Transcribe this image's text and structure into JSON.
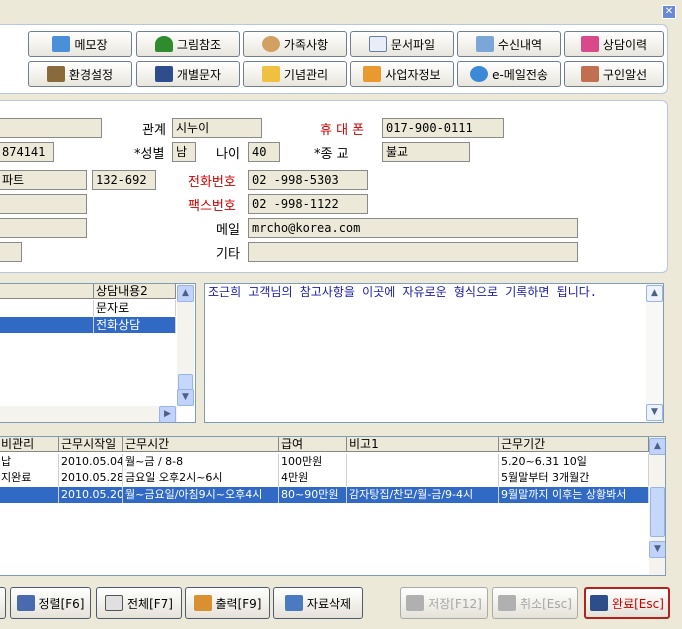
{
  "toolbar_top": [
    {
      "label": "메모장",
      "icon": "memo-icon"
    },
    {
      "label": "그림참조",
      "icon": "tree-icon"
    },
    {
      "label": "가족사항",
      "icon": "family-icon"
    },
    {
      "label": "문서파일",
      "icon": "document-icon"
    },
    {
      "label": "수신내역",
      "icon": "inbox-icon"
    },
    {
      "label": "상담이력",
      "icon": "history-icon"
    }
  ],
  "toolbar_bottom": [
    {
      "label": "환경설정",
      "icon": "settings-icon"
    },
    {
      "label": "개별문자",
      "icon": "sms-icon"
    },
    {
      "label": "기념관리",
      "icon": "anniversary-icon"
    },
    {
      "label": "사업자정보",
      "icon": "business-icon"
    },
    {
      "label": "e-메일전송",
      "icon": "email-icon"
    },
    {
      "label": "구인알선",
      "icon": "recruit-icon"
    }
  ],
  "info": {
    "relation_label": "관계",
    "relation_value": "시누이",
    "mobile_label": "휴 대 폰",
    "mobile_value": "017-900-0111",
    "idnum_value": "874141",
    "gender_label": "*성별",
    "gender_value": "남",
    "age_label": "나이",
    "age_value": "40",
    "religion_label": "*종     교",
    "religion_value": "불교",
    "address_value": "파트",
    "zip_value": "132-692",
    "phone_label": "전화번호",
    "phone_value": "02  -998-5303",
    "fax_label": "팩스번호",
    "fax_value": "02  -998-1122",
    "email_label": "메일",
    "email_value": "mrcho@korea.com",
    "etc_label": "기타",
    "etc_value": ""
  },
  "consult_list": {
    "header": "상담내용2",
    "rows": [
      "문자로",
      "전화상담"
    ],
    "selected_index": 1
  },
  "memo_text": "조근희 고객님의 참고사항을 이곳에 자유로운 형식으로 기록하면 됩니다.",
  "work_table": {
    "headers": [
      "비관리",
      "근무시작일",
      "근무시간",
      "급여",
      "비고1",
      "근무기간"
    ],
    "rows": [
      [
        "납",
        "2010.05.04",
        "월~금 / 8-8",
        "100만원",
        "",
        "5.20~6.31 10일"
      ],
      [
        "지완료",
        "2010.05.28",
        "금요일 오후2시~6시",
        "4만원",
        "",
        "5월말부터 3개월간"
      ],
      [
        "",
        "2010.05.20",
        "월~금요일/아침9시~오후4시",
        "80~90만원",
        "감자탕집/찬모/월-금/9-4시",
        "9월말까지 이후는 상황봐서"
      ]
    ],
    "selected_index": 2
  },
  "bottom_buttons": [
    {
      "label": "정렬[F6]",
      "icon": "sort-icon",
      "enabled": true
    },
    {
      "label": "전체[F7]",
      "icon": "all-icon",
      "enabled": true
    },
    {
      "label": "출력[F9]",
      "icon": "print-icon",
      "enabled": true
    },
    {
      "label": "자료삭제",
      "icon": "delete-icon",
      "enabled": true
    },
    {
      "label": "저장[F12]",
      "icon": "save-icon",
      "enabled": false
    },
    {
      "label": "취소[Esc]",
      "icon": "cancel-icon",
      "enabled": false
    },
    {
      "label": "완료[Esc]",
      "icon": "done-icon",
      "enabled": true
    }
  ],
  "colors": {
    "accent_red": "#cc0000",
    "selection_blue": "#316ac5",
    "memo_text_blue": "#1a1aa6"
  }
}
